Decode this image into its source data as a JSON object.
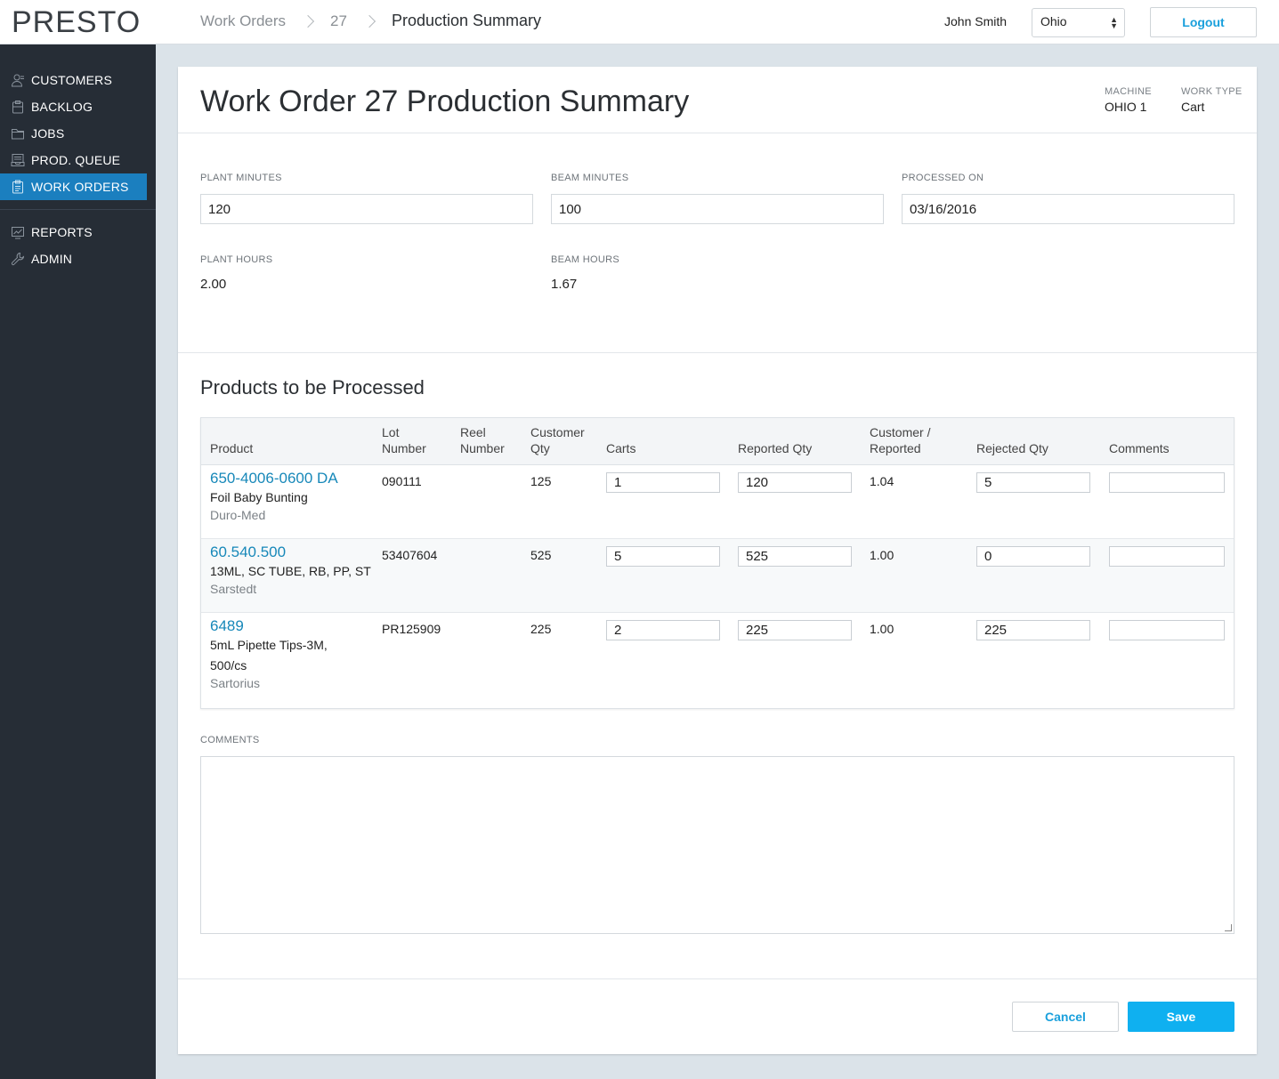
{
  "app": {
    "logo": "PRESTO"
  },
  "breadcrumb": {
    "items": [
      "Work Orders",
      "27"
    ],
    "current": "Production Summary"
  },
  "header": {
    "user": "John Smith",
    "region": "Ohio",
    "logout_label": "Logout"
  },
  "sidebar": {
    "items": [
      {
        "label": "CUSTOMERS",
        "icon": "user-icon"
      },
      {
        "label": "BACKLOG",
        "icon": "clipboard-icon"
      },
      {
        "label": "JOBS",
        "icon": "folder-icon"
      },
      {
        "label": "PROD. QUEUE",
        "icon": "inbox-icon"
      },
      {
        "label": "WORK ORDERS",
        "icon": "document-icon",
        "active": true
      },
      {
        "label": "REPORTS",
        "icon": "chart-icon"
      },
      {
        "label": "ADMIN",
        "icon": "wrench-icon"
      }
    ],
    "active_color": "#1b7fbf"
  },
  "page": {
    "title": "Work Order 27 Production Summary",
    "machine_label": "MACHINE",
    "machine_value": "OHIO 1",
    "work_type_label": "WORK TYPE",
    "work_type_value": "Cart"
  },
  "summary": {
    "plant_minutes_label": "PLANT MINUTES",
    "plant_minutes": "120",
    "beam_minutes_label": "BEAM MINUTES",
    "beam_minutes": "100",
    "processed_on_label": "PROCESSED ON",
    "processed_on": "03/16/2016",
    "plant_hours_label": "PLANT HOURS",
    "plant_hours": "2.00",
    "beam_hours_label": "BEAM HOURS",
    "beam_hours": "1.67"
  },
  "products": {
    "title": "Products to be Processed",
    "columns": {
      "product": "Product",
      "lot_1": "Lot",
      "lot_2": "Number",
      "reel_1": "Reel",
      "reel_2": "Number",
      "cust_1": "Customer",
      "cust_2": "Qty",
      "carts": "Carts",
      "reported": "Reported Qty",
      "ratio_1": "Customer /",
      "ratio_2": "Reported",
      "rejected": "Rejected Qty",
      "comments": "Comments"
    },
    "rows": [
      {
        "code": "650-4006-0600 DA",
        "desc1": "Foil Baby Bunting",
        "desc2": "",
        "maker": "Duro-Med",
        "lot": "090111",
        "reel": "",
        "cust_qty": "125",
        "carts": "1",
        "reported": "120",
        "ratio": "1.04",
        "rejected": "5",
        "comments": ""
      },
      {
        "code": "60.540.500",
        "desc1": "13ML, SC TUBE, RB, PP, ST",
        "desc2": "",
        "maker": "Sarstedt",
        "lot": "53407604",
        "reel": "",
        "cust_qty": "525",
        "carts": "5",
        "reported": "525",
        "ratio": "1.00",
        "rejected": "0",
        "comments": ""
      },
      {
        "code": "6489",
        "desc1": "5mL Pipette Tips-3M,",
        "desc2": "500/cs",
        "maker": "Sartorius",
        "lot": "PR125909",
        "reel": "",
        "cust_qty": "225",
        "carts": "2",
        "reported": "225",
        "ratio": "1.00",
        "rejected": "225",
        "comments": ""
      }
    ]
  },
  "comments": {
    "label": "COMMENTS",
    "value": ""
  },
  "actions": {
    "cancel_label": "Cancel",
    "save_label": "Save"
  },
  "colors": {
    "accent": "#1aa0dc",
    "link": "#1788b9",
    "sidebar_bg": "#262d36",
    "save_bg": "#0fb0f0"
  }
}
